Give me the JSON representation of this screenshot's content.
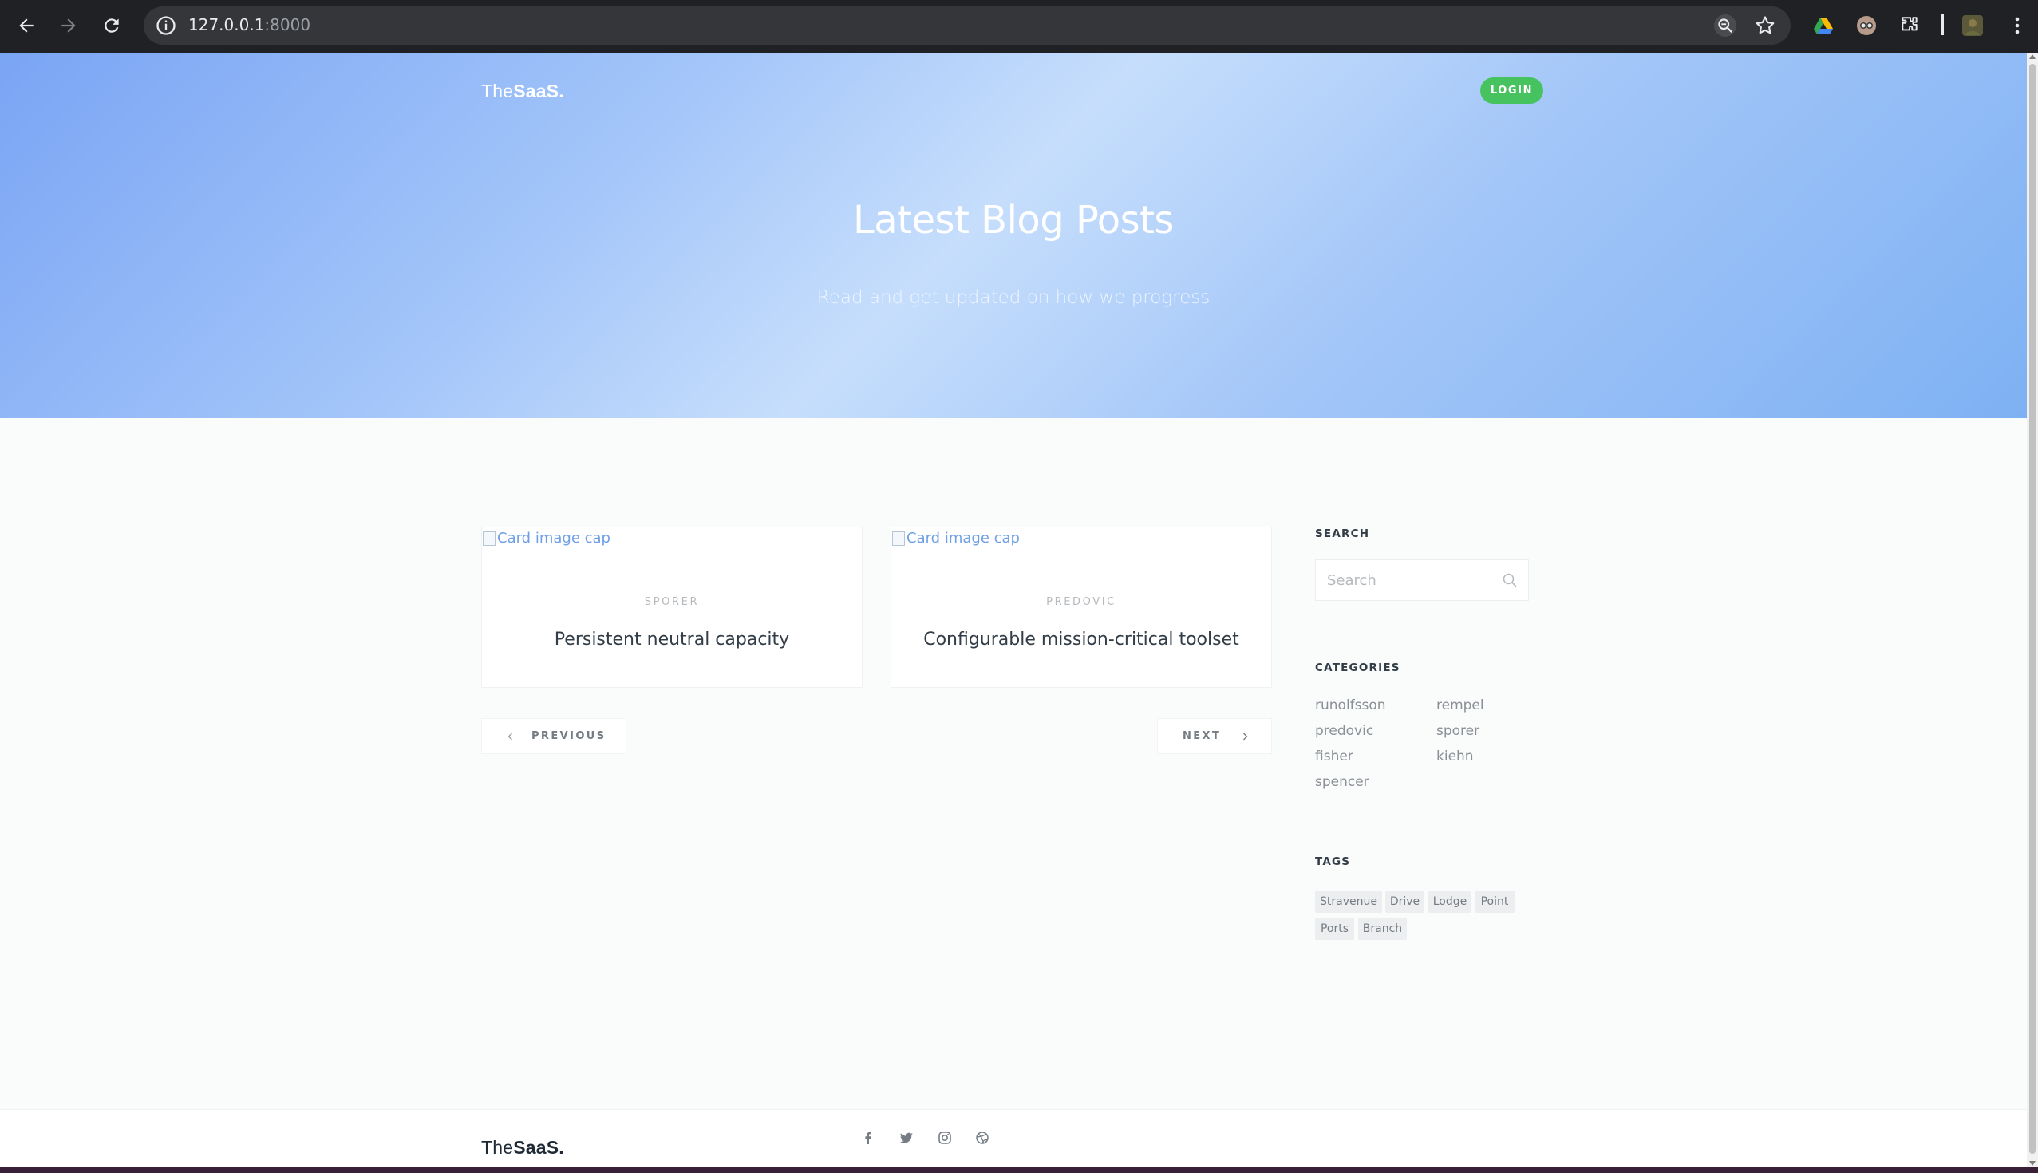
{
  "browser": {
    "url_host": "127.0.0.1",
    "url_port": ":8000"
  },
  "site": {
    "logo_thin": "The",
    "logo_bold": "SaaS."
  },
  "header": {
    "login_label": "LOGIN"
  },
  "hero": {
    "title": "Latest Blog Posts",
    "subtitle": "Read and get updated on how we progress"
  },
  "posts": [
    {
      "image_alt": "Card image cap",
      "author": "SPORER",
      "title": "Persistent neutral capacity"
    },
    {
      "image_alt": "Card image cap",
      "author": "PREDOVIC",
      "title": "Configurable mission-critical toolset"
    }
  ],
  "pagination": {
    "previous_label": "PREVIOUS",
    "next_label": "NEXT"
  },
  "sidebar": {
    "search_heading": "SEARCH",
    "search_placeholder": "Search",
    "categories_heading": "CATEGORIES",
    "categories": [
      "runolfsson",
      "rempel",
      "predovic",
      "sporer",
      "fisher",
      "kiehn",
      "spencer"
    ],
    "tags_heading": "TAGS",
    "tags": [
      "Stravenue",
      "Drive",
      "Lodge",
      "Point",
      "Ports",
      "Branch"
    ]
  },
  "footer": {
    "social_icons": [
      "facebook-icon",
      "twitter-icon",
      "instagram-icon",
      "dribbble-icon"
    ]
  },
  "colors": {
    "login_button": "#46c35f",
    "hero_gradient_start": "#7aa5f4",
    "hero_gradient_mid": "#c6defc",
    "link_blue": "#6fa0e6",
    "tag_bg": "#eceef0"
  }
}
